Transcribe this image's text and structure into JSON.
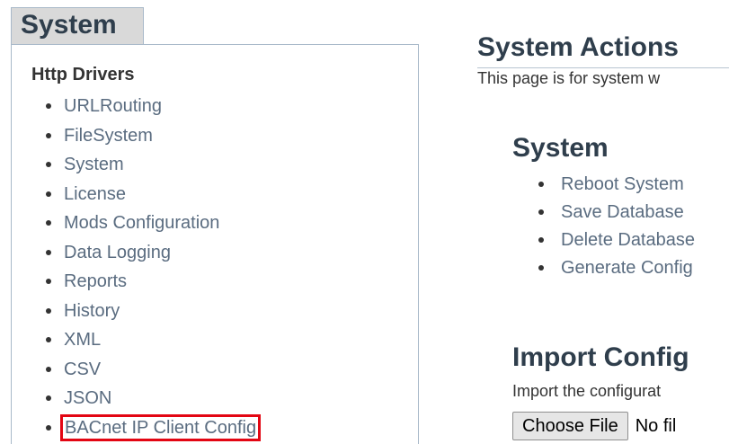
{
  "left_panel": {
    "tab_title": "System",
    "heading": "Http Drivers",
    "items": [
      "URLRouting",
      "FileSystem",
      "System",
      "License",
      "Mods Configuration",
      "Data Logging",
      "Reports",
      "History",
      "XML",
      "CSV",
      "JSON",
      "BACnet IP Client Config"
    ],
    "highlighted_item": "BACnet IP Client Config"
  },
  "right_panel": {
    "title": "System Actions",
    "description": "This page is for system w",
    "system_section": {
      "title": "System",
      "items": [
        "Reboot System",
        "Save Database",
        "Delete Database",
        "Generate Config"
      ]
    },
    "import_section": {
      "title": "Import Config",
      "description": "Import the configurat",
      "choose_file_label": "Choose File",
      "file_status": "No fil"
    }
  },
  "colors": {
    "link": "#5a6c80",
    "heading": "#2f3e4c",
    "border": "#a9b9c9",
    "highlight": "#e30613",
    "tab_background": "#d9d9d9"
  }
}
